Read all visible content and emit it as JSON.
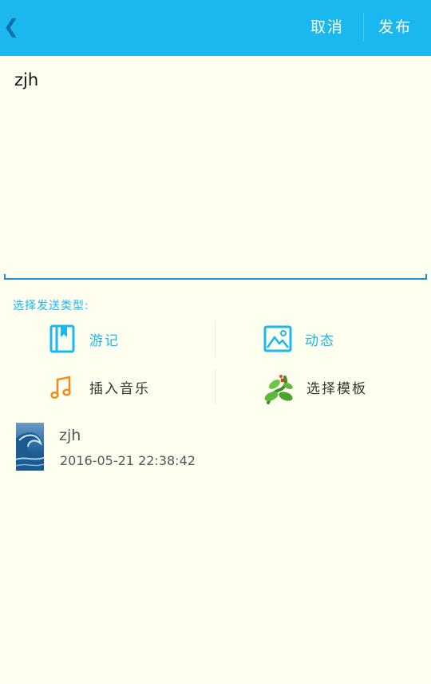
{
  "header": {
    "back_icon": "chevron-left-icon",
    "back_glyph": "❮",
    "cancel_label": "取消",
    "publish_label": "发布",
    "colors": {
      "bar": "#1ab8ee",
      "text": "#ffffff",
      "back": "#0d6fa8"
    }
  },
  "editor": {
    "value": "zjh",
    "underline_color": "#1b8fd6"
  },
  "send_type": {
    "label": "选择发送类型:",
    "options": [
      {
        "label": "游记",
        "icon": "bookmark-book-icon",
        "color": "#1ab8ee"
      },
      {
        "label": "动态",
        "icon": "image-icon",
        "color": "#1ab8ee"
      },
      {
        "label": "插入音乐",
        "icon": "music-note-icon",
        "color": "#f08c1c"
      },
      {
        "label": "选择模板",
        "icon": "plant-template-icon",
        "color": "#4a9d2c"
      }
    ]
  },
  "preview": {
    "name": "zjh",
    "timestamp": "2016-05-21 22:38:42",
    "thumbnail_icon": "ocean-wave-thumbnail"
  }
}
